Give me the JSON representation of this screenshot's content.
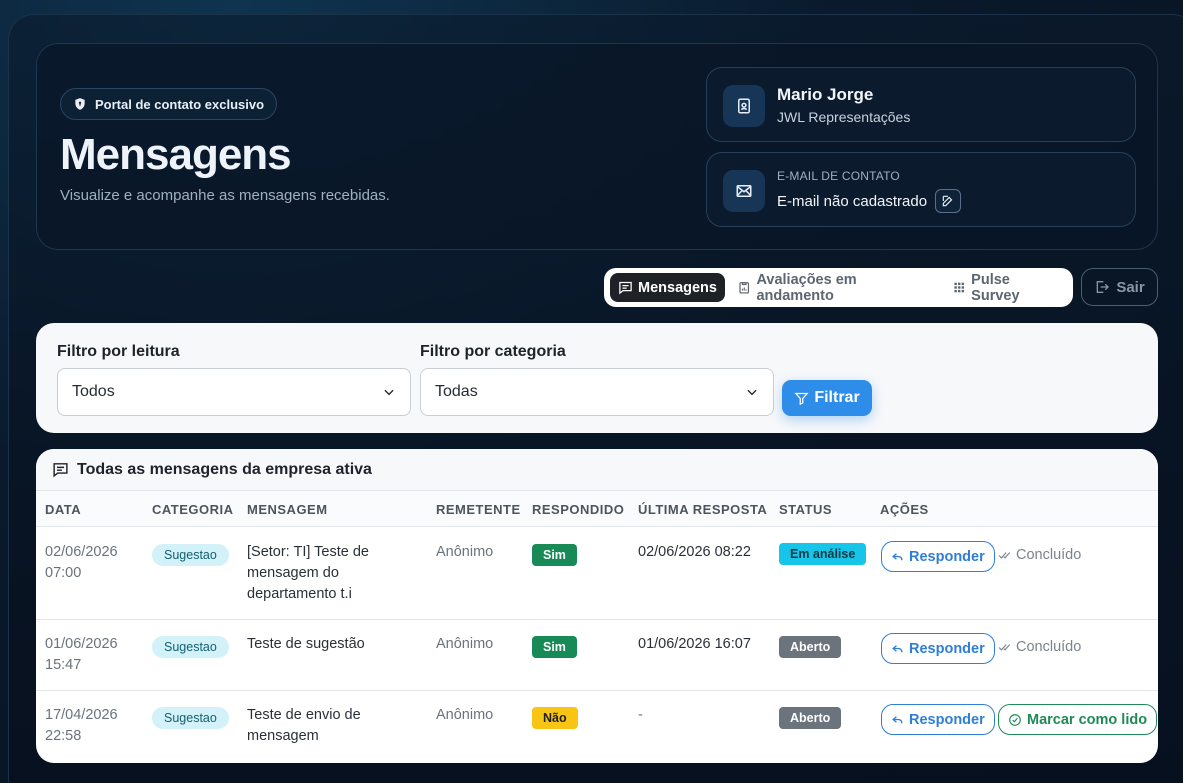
{
  "header": {
    "badge": "Portal de contato exclusivo",
    "title": "Mensagens",
    "subtitle": "Visualize e acompanhe as mensagens recebidas."
  },
  "profile": {
    "name": "Mario Jorge",
    "company": "JWL Representações",
    "email_caption": "E-MAIL DE CONTATO",
    "email_value": "E-mail não cadastrado"
  },
  "nav": {
    "tabs": [
      {
        "label": "Mensagens",
        "icon": "message-square-icon",
        "active": true
      },
      {
        "label": "Avaliações em andamento",
        "icon": "clipboard-chart-icon",
        "active": false
      },
      {
        "label": "Pulse Survey",
        "icon": "grid-icon",
        "active": false
      }
    ],
    "logout": "Sair"
  },
  "filters": {
    "reading_label": "Filtro por leitura",
    "reading_value": "Todos",
    "category_label": "Filtro por categoria",
    "category_value": "Todas",
    "button": "Filtrar"
  },
  "table": {
    "title": "Todas as mensagens da empresa ativa",
    "columns": [
      "DATA",
      "CATEGORIA",
      "MENSAGEM",
      "REMETENTE",
      "RESPONDIDO",
      "ÚLTIMA RESPOSTA",
      "STATUS",
      "AÇÕES"
    ],
    "rows": [
      {
        "date": "02/06/2026",
        "time": "07:00",
        "category": "Sugestao",
        "message_lines": [
          "[Setor: TI] Teste de",
          "mensagem do",
          "departamento t.i"
        ],
        "sender": "Anônimo",
        "answered": "Sim",
        "last_reply": "02/06/2026 08:22",
        "status": "Em análise",
        "action_primary": "Responder",
        "action_secondary": "Concluído"
      },
      {
        "date": "01/06/2026",
        "time": "15:47",
        "category": "Sugestao",
        "message_lines": [
          "Teste de sugestão"
        ],
        "sender": "Anônimo",
        "answered": "Sim",
        "last_reply": "01/06/2026 16:07",
        "status": "Aberto",
        "action_primary": "Responder",
        "action_secondary": "Concluído"
      },
      {
        "date": "17/04/2026",
        "time": "22:58",
        "category": "Sugestao",
        "message_lines": [
          "Teste de envio de",
          "mensagem"
        ],
        "sender": "Anônimo",
        "answered": "Não",
        "last_reply": "-",
        "status": "Aberto",
        "action_primary": "Responder",
        "action_secondary": "Marcar como lido"
      }
    ]
  }
}
